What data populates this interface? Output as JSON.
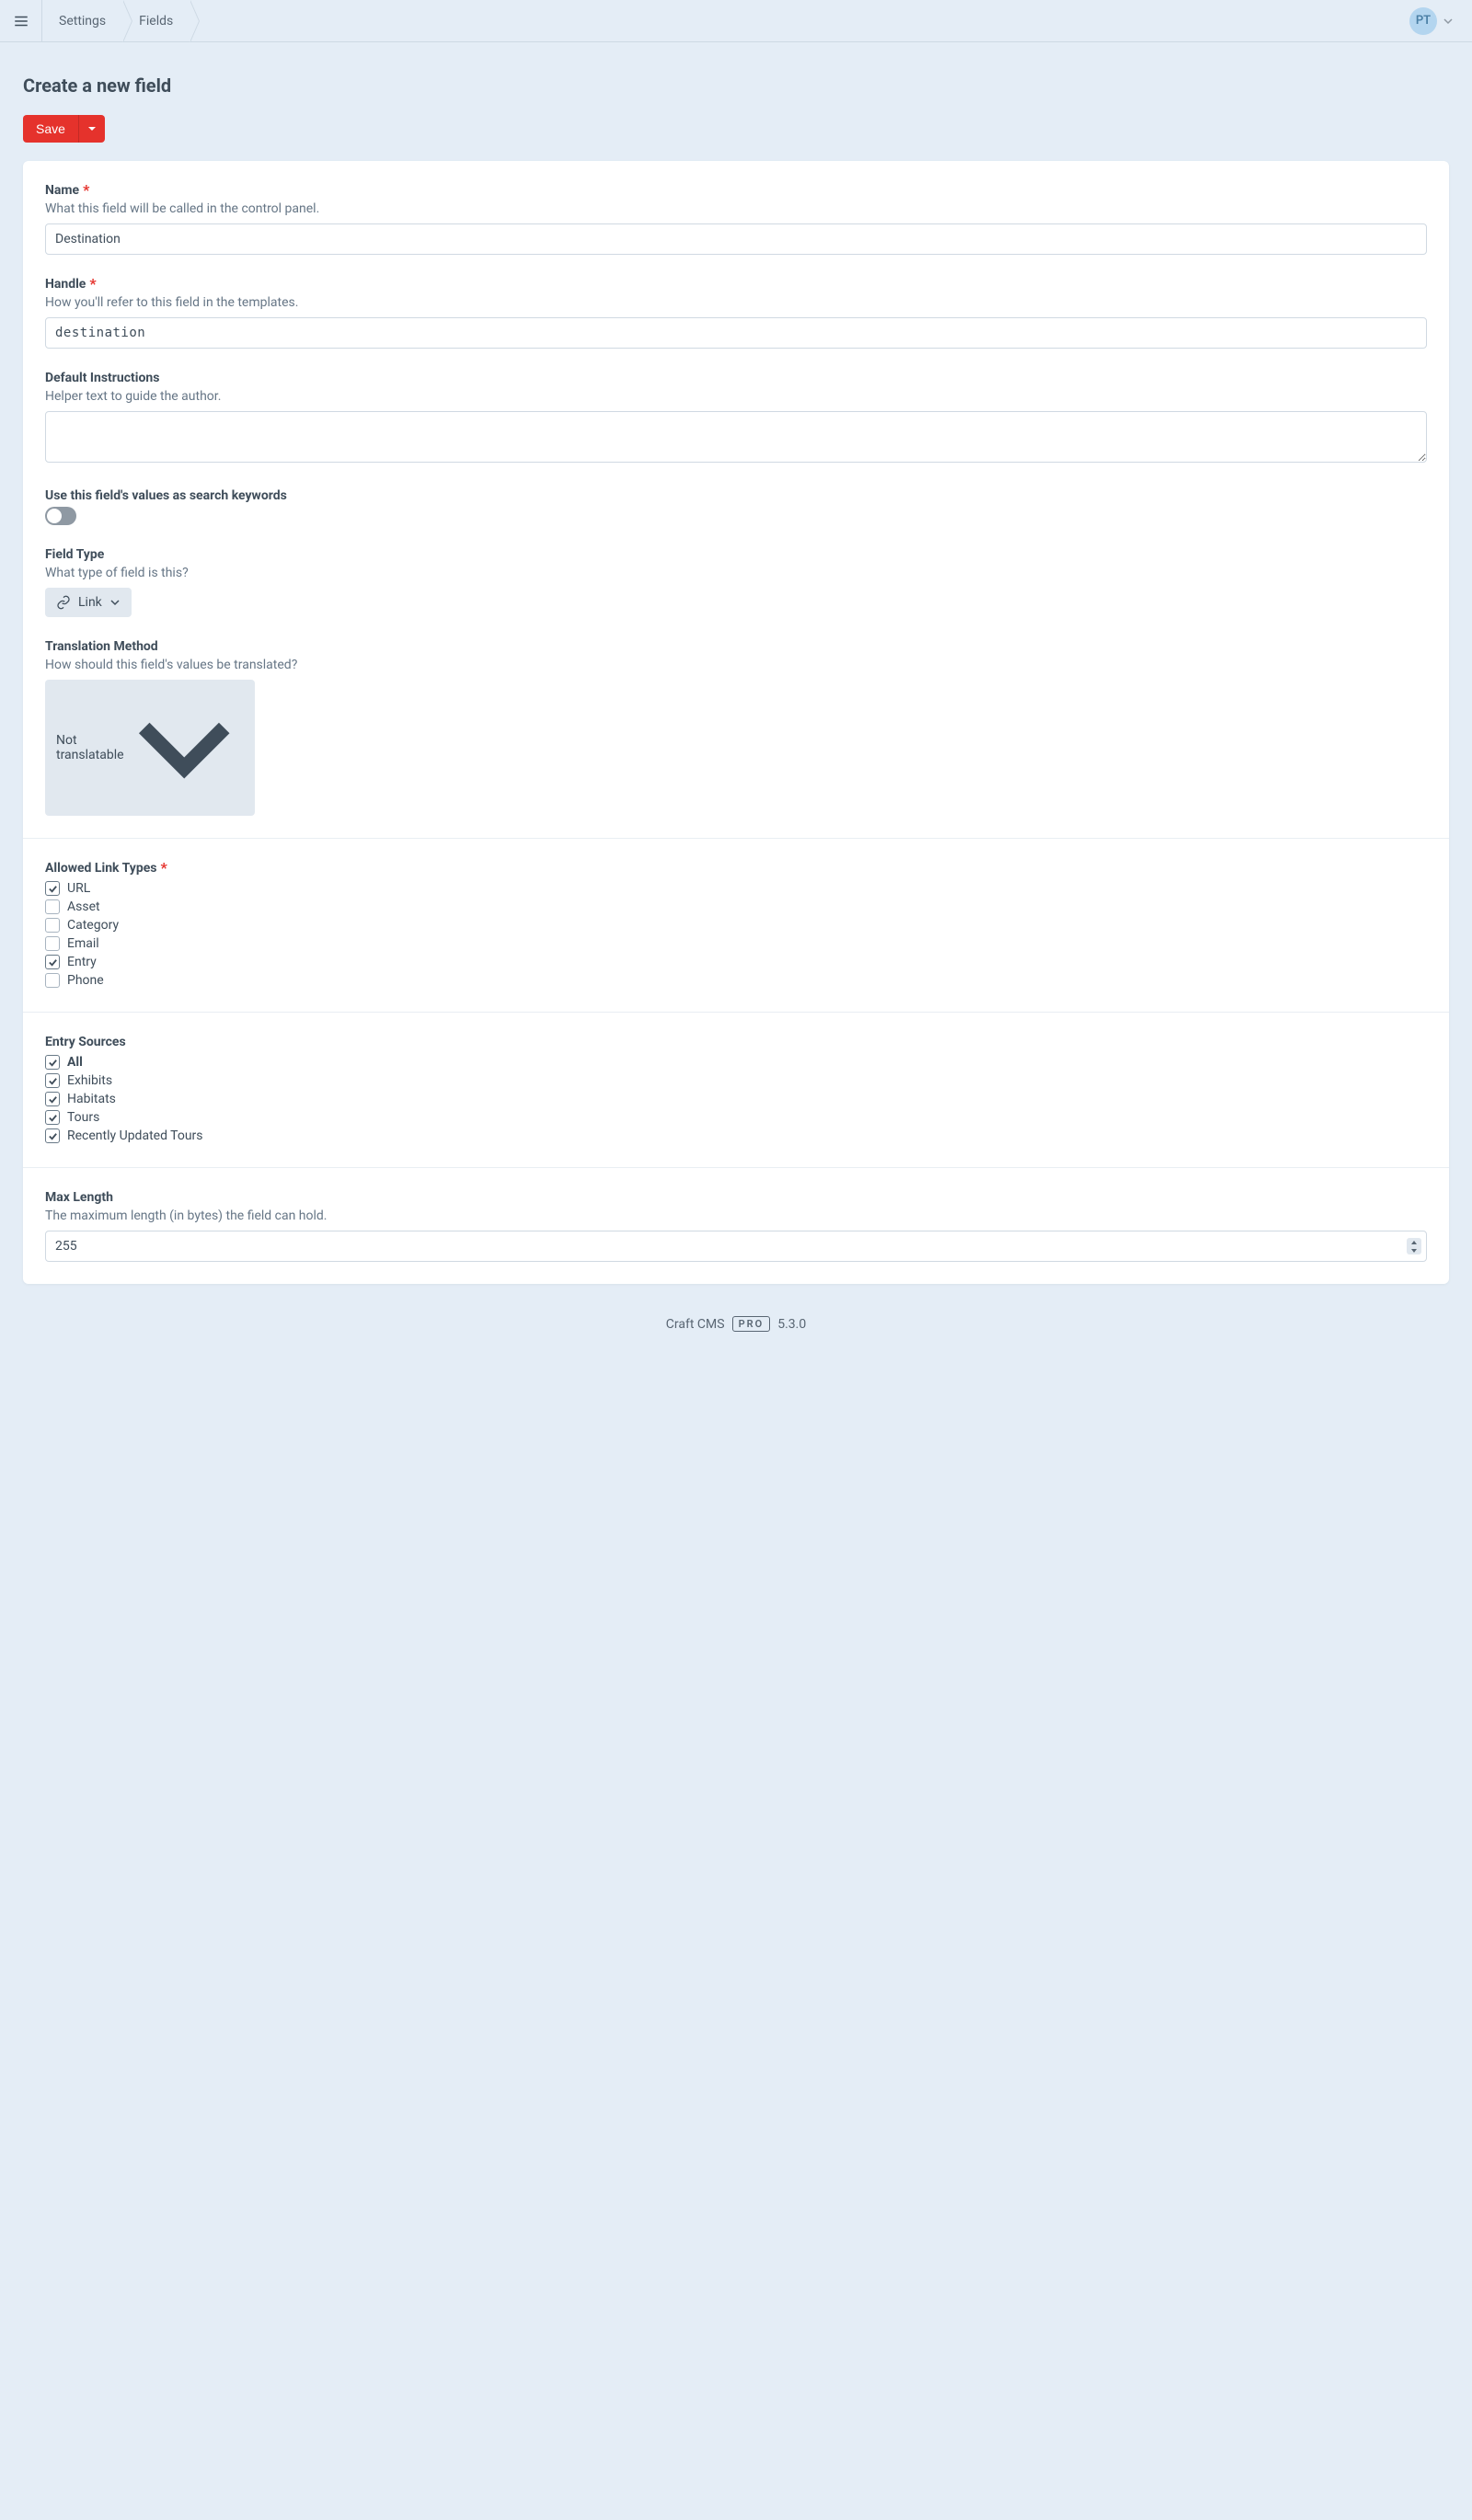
{
  "breadcrumbs": [
    "Settings",
    "Fields"
  ],
  "user_initials": "PT",
  "page_title": "Create a new field",
  "save_label": "Save",
  "fields": {
    "name": {
      "label": "Name",
      "help": "What this field will be called in the control panel.",
      "value": "Destination",
      "required": true
    },
    "handle": {
      "label": "Handle",
      "help": "How you'll refer to this field in the templates.",
      "value": "destination",
      "required": true
    },
    "instructions": {
      "label": "Default Instructions",
      "help": "Helper text to guide the author.",
      "value": ""
    },
    "search": {
      "label": "Use this field's values as search keywords",
      "on": false
    },
    "type": {
      "label": "Field Type",
      "help": "What type of field is this?",
      "value": "Link"
    },
    "translation": {
      "label": "Translation Method",
      "help": "How should this field's values be translated?",
      "value": "Not translatable"
    },
    "allowed": {
      "label": "Allowed Link Types",
      "required": true,
      "options": [
        {
          "label": "URL",
          "checked": true
        },
        {
          "label": "Asset",
          "checked": false
        },
        {
          "label": "Category",
          "checked": false
        },
        {
          "label": "Email",
          "checked": false
        },
        {
          "label": "Entry",
          "checked": true
        },
        {
          "label": "Phone",
          "checked": false
        }
      ]
    },
    "sources": {
      "label": "Entry Sources",
      "options": [
        {
          "label": "All",
          "checked": true,
          "bold": true
        },
        {
          "label": "Exhibits",
          "checked": true
        },
        {
          "label": "Habitats",
          "checked": true
        },
        {
          "label": "Tours",
          "checked": true
        },
        {
          "label": "Recently Updated Tours",
          "checked": true
        }
      ]
    },
    "maxlen": {
      "label": "Max Length",
      "help": "The maximum length (in bytes) the field can hold.",
      "value": "255"
    }
  },
  "footer": {
    "product": "Craft CMS",
    "edition": "PRO",
    "version": "5.3.0"
  }
}
